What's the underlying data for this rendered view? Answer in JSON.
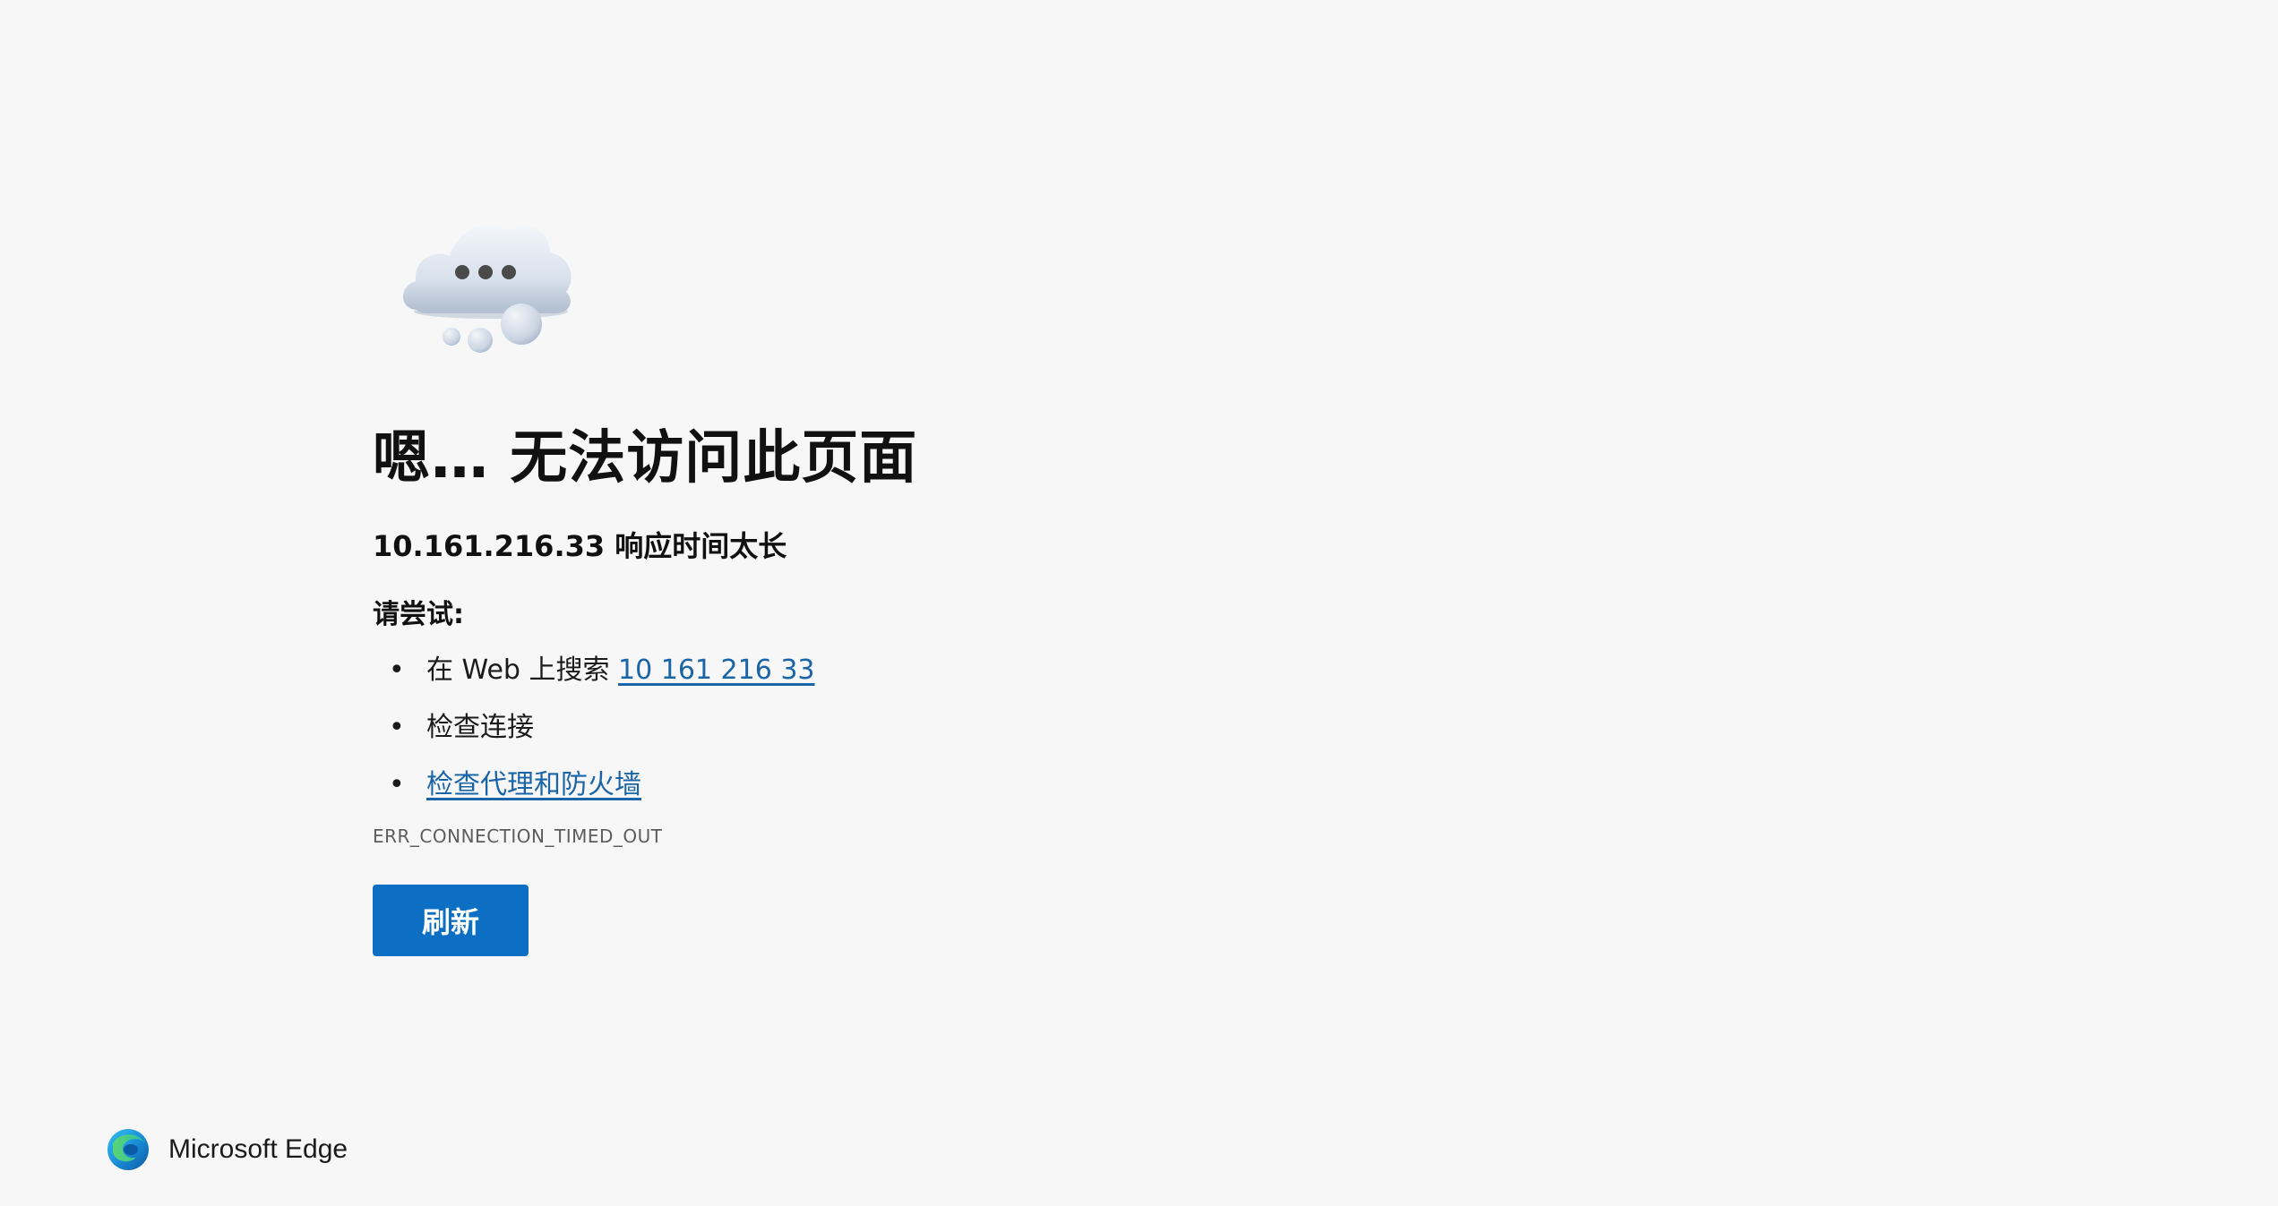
{
  "illustration": {
    "icon": "cloud-with-dots-icon"
  },
  "error": {
    "headline": "嗯… 无法访问此页面",
    "subheadline": "10.161.216.33 响应时间太长",
    "try_label": "请尝试:",
    "suggestions": [
      {
        "prefix": "在 Web 上搜索 ",
        "link": "10 161 216 33"
      },
      {
        "text": "检查连接"
      },
      {
        "link": "检查代理和防火墙"
      }
    ],
    "code": "ERR_CONNECTION_TIMED_OUT"
  },
  "actions": {
    "refresh_label": "刷新"
  },
  "footer": {
    "brand": "Microsoft Edge",
    "icon": "edge-logo-icon"
  },
  "colors": {
    "background": "#f7f7f7",
    "link": "#1a64a8",
    "button": "#0c6fc3",
    "text": "#1b1b1b"
  }
}
